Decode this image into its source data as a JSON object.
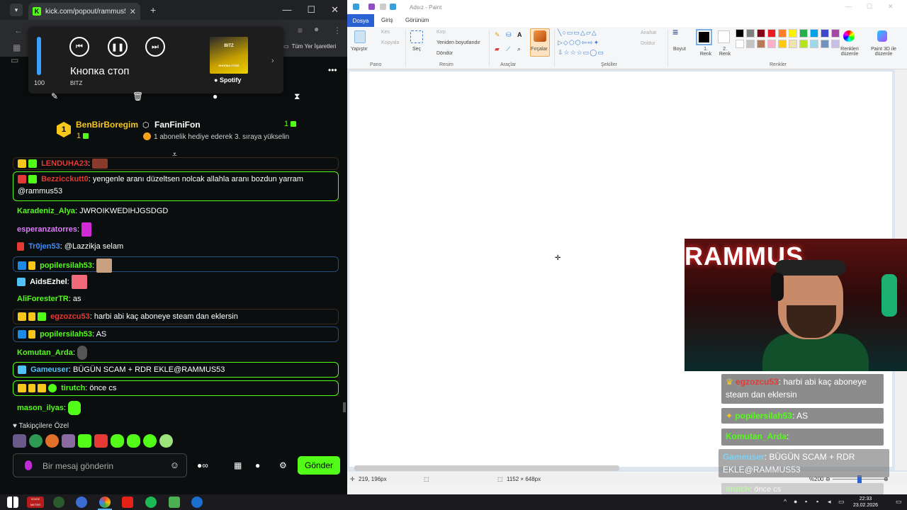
{
  "browser": {
    "tab_title": "kick.com/popout/rammus53/c",
    "bookmarks_label": "Tüm Yer İşaretleri"
  },
  "media": {
    "volume": 100,
    "song": "Кнопка стоп",
    "artist": "BITZ",
    "cover_text": "BITZ",
    "cover_subtext": "КНОПКА СТОП",
    "source": "Spotify"
  },
  "gifters": {
    "first": {
      "rank": "1",
      "name": "BenBirBoregim",
      "count": "1"
    },
    "second": {
      "name": "FanFiniFon",
      "count": "1",
      "message": "1 abonelik hediye ederek 3. sıraya yükselin"
    }
  },
  "chat": {
    "messages": [
      {
        "user": "LENDUHA23",
        "sep": ":",
        "text": ""
      },
      {
        "user": "Bezzicckutt0",
        "sep": ":",
        "text": "yengenle aranı düzeltsen nolcak allahla aranı bozdun yarram @rammus53"
      },
      {
        "user": "Karadeniz_Alya",
        "sep": ":",
        "text": "JWROIKWEDIHJGSDGD"
      },
      {
        "user": "esperanzatorres",
        "sep": ":",
        "text": ""
      },
      {
        "user": "Tr0jen53",
        "sep": ":",
        "text": "@Lazzikja selam"
      },
      {
        "user": "popilersilah53",
        "sep": ":",
        "text": ""
      },
      {
        "user": "AidsEzhel",
        "sep": ":",
        "text": ""
      },
      {
        "user": "AliForesterTR",
        "sep": ":",
        "text": "as"
      },
      {
        "user": "egzozcu53",
        "sep": ":",
        "text": "harbi abi kaç aboneye steam dan eklersin"
      },
      {
        "user": "popilersilah53",
        "sep": ":",
        "text": "AS"
      },
      {
        "user": "Komutan_Arda",
        "sep": ":",
        "text": ""
      },
      {
        "user": "Gameuser",
        "sep": ":",
        "text": "BÜGÜN SCAM + RDR EKLE@RAMMUS53"
      },
      {
        "user": "tirutch",
        "sep": ":",
        "text": "önce cs"
      },
      {
        "user": "mason_ilyas",
        "sep": ":",
        "text": ""
      }
    ],
    "followers_label": "Takipçilere Özel",
    "input_placeholder": "Bir mesaj gönderin",
    "send_label": "Gönder"
  },
  "paint": {
    "title": "Adsız - Paint",
    "tabs": {
      "file": "Dosya",
      "home": "Giriş",
      "view": "Görünüm"
    },
    "ribbon": {
      "paste": "Yapıştır",
      "cut": "Kes",
      "copy": "Kopyala",
      "select": "Seç",
      "crop": "Kırp",
      "resize": "Yeniden boyutlandır",
      "rotate": "Döndür",
      "brushes": "Fırçalar",
      "outline": "Anahat",
      "fill": "Doldur",
      "size": "Boyut",
      "color1": "1. Renk",
      "color2": "2. Renk",
      "edit_colors": "Renkleri düzenle",
      "paint3d": "Paint 3D ile düzenle",
      "group_clipboard": "Pano",
      "group_image": "Resim",
      "group_tools": "Araçlar",
      "group_shapes": "Şekiller",
      "group_colors": "Renkler"
    },
    "palette": [
      "#000000",
      "#7f7f7f",
      "#880015",
      "#ed1c24",
      "#ff7f27",
      "#fff200",
      "#22b14c",
      "#00a2e8",
      "#3f48cc",
      "#a349a4",
      "#ffffff",
      "#c3c3c3",
      "#b97a57",
      "#ffaec9",
      "#ffc90e",
      "#efe4b0",
      "#b5e61d",
      "#99d9ea",
      "#7092be",
      "#c8bfe7"
    ],
    "status": {
      "cursor": "219, 196px",
      "size": "1152 × 648px",
      "zoom": "%200"
    }
  },
  "overlay": {
    "banner": "RAMMUS",
    "chat": [
      {
        "user": "egzozcu53",
        "sep": ":",
        "text": "harbi abi kaç aboneye steam dan eklersin"
      },
      {
        "user": "popilersilah53",
        "sep": ":",
        "text": "AS"
      },
      {
        "user": "Komutan_Arda",
        "sep": ":",
        "text": ""
      },
      {
        "user": "Gameuser",
        "sep": ":",
        "text": "BÜGÜN SCAM + RDR EKLE@RAMMUS53"
      },
      {
        "user": "tirutch",
        "sep": ":",
        "text": "önce cs"
      }
    ]
  },
  "taskbar": {
    "time": "22:33",
    "date": "23.02.2026",
    "voice_label": "VOICE METER"
  }
}
